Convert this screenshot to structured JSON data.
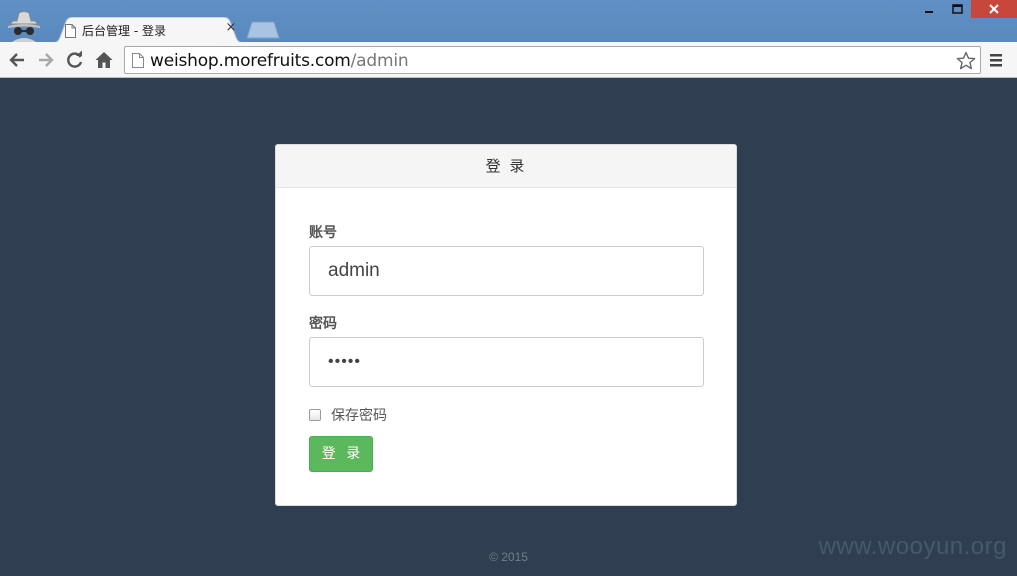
{
  "browser": {
    "tab": {
      "title": "后台管理 - 登录",
      "close_glyph": "×"
    },
    "window_controls": {
      "minimize": "▁",
      "maximize": "□",
      "close": "✕"
    },
    "address_bar": {
      "host": "weishop.morefruits.com",
      "path": "/admin"
    }
  },
  "login": {
    "heading": "登 录",
    "username_label": "账号",
    "username_value": "admin",
    "password_label": "密码",
    "password_value": "•••••",
    "remember_label": "保存密码",
    "remember_checked": false,
    "submit_label": "登 录"
  },
  "footer": {
    "copyright": "© 2015"
  },
  "watermark": "www.wooyun.org",
  "colors": {
    "page_background": "#2f3f51",
    "submit_button": "#5cb85c",
    "browser_frame": "#5a89bd",
    "close_button": "#c7473d"
  },
  "icons": [
    "incognito-icon",
    "document-icon",
    "back-icon",
    "forward-icon",
    "reload-icon",
    "home-icon",
    "star-icon",
    "menu-icon"
  ]
}
